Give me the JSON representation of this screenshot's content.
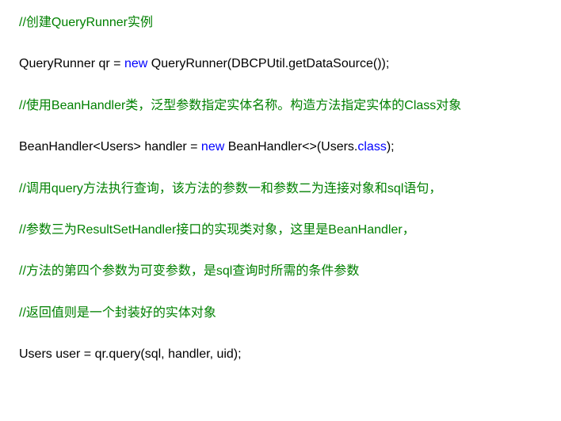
{
  "code": {
    "line1_comment": "//创建QueryRunner实例",
    "line2_p1": "QueryRunner qr = ",
    "line2_kw": "new",
    "line2_p2": " QueryRunner(DBCPUtil.getDataSource());",
    "line3_comment": "//使用BeanHandler类，泛型参数指定实体名称。构造方法指定实体的Class对象",
    "line4_p1": "BeanHandler<Users> handler = ",
    "line4_kw1": "new",
    "line4_p2": " BeanHandler<>(Users.",
    "line4_kw2": "class",
    "line4_p3": ");",
    "line5_comment": "//调用query方法执行查询，该方法的参数一和参数二为连接对象和sql语句，",
    "line6_comment": "//参数三为ResultSetHandler接口的实现类对象，这里是BeanHandler，",
    "line7_comment": "//方法的第四个参数为可变参数，是sql查询时所需的条件参数",
    "line8_comment": "//返回值则是一个封装好的实体对象",
    "line9_p1": "Users user = qr.query(sql, handler, uid);"
  }
}
